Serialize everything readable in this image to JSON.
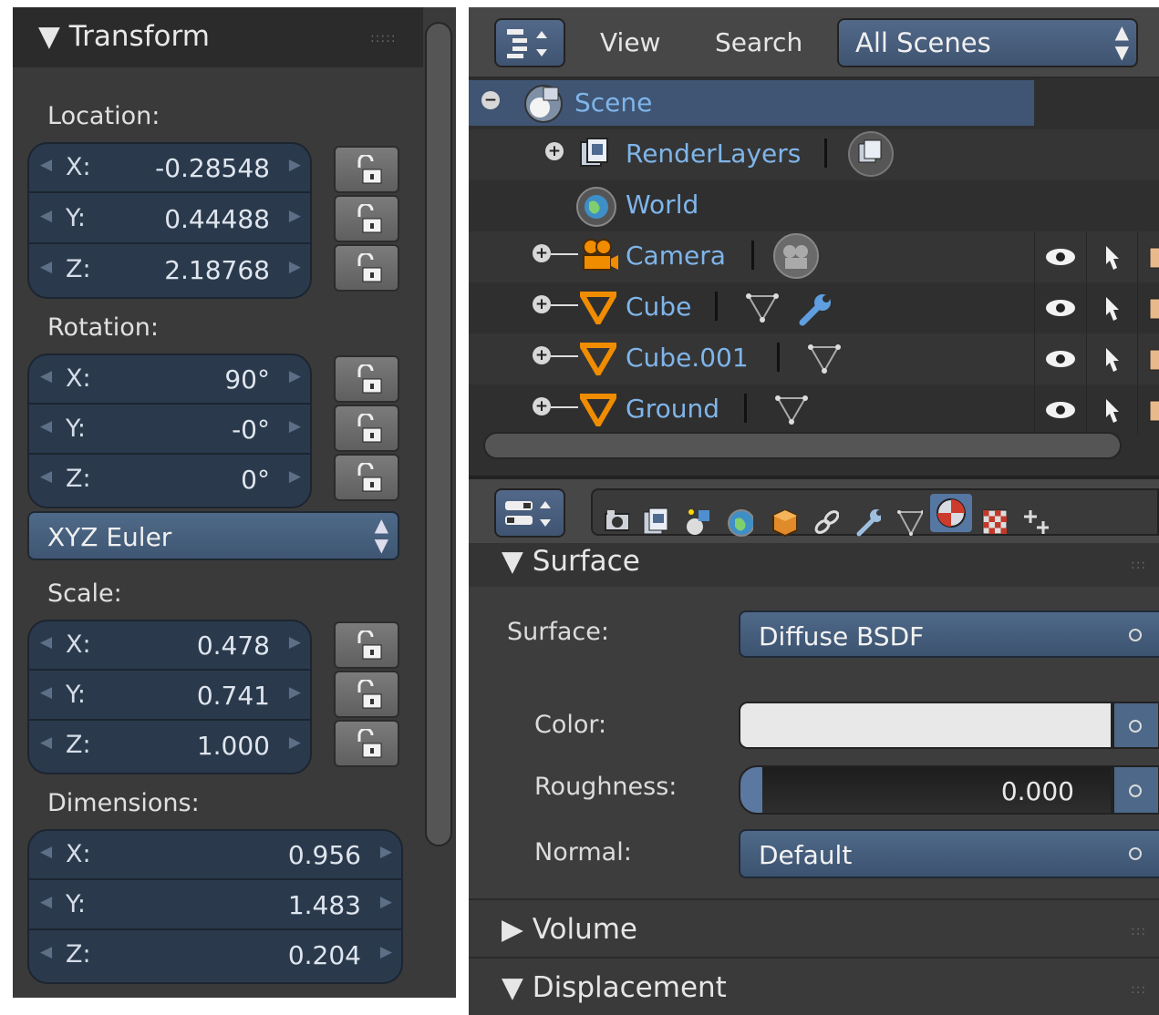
{
  "transform": {
    "title": "Transform",
    "location": {
      "label": "Location:",
      "fields": [
        {
          "axis": "X:",
          "value": "-0.28548"
        },
        {
          "axis": "Y:",
          "value": "0.44488"
        },
        {
          "axis": "Z:",
          "value": "2.18768"
        }
      ]
    },
    "rotation": {
      "label": "Rotation:",
      "fields": [
        {
          "axis": "X:",
          "value": "90°"
        },
        {
          "axis": "Y:",
          "value": "-0°"
        },
        {
          "axis": "Z:",
          "value": "0°"
        }
      ],
      "mode": "XYZ Euler"
    },
    "scale": {
      "label": "Scale:",
      "fields": [
        {
          "axis": "X:",
          "value": "0.478"
        },
        {
          "axis": "Y:",
          "value": "0.741"
        },
        {
          "axis": "Z:",
          "value": "1.000"
        }
      ]
    },
    "dimensions": {
      "label": "Dimensions:",
      "fields": [
        {
          "axis": "X:",
          "value": "0.956"
        },
        {
          "axis": "Y:",
          "value": "1.483"
        },
        {
          "axis": "Z:",
          "value": "0.204"
        }
      ]
    }
  },
  "outliner": {
    "menu": {
      "view": "View",
      "search": "Search"
    },
    "scenes_dropdown": "All Scenes",
    "rows": [
      {
        "name": "Scene",
        "icon": "scene-icon"
      },
      {
        "name": "RenderLayers",
        "icon": "render-layers-icon"
      },
      {
        "name": "World",
        "icon": "world-icon"
      },
      {
        "name": "Camera",
        "icon": "camera-icon"
      },
      {
        "name": "Cube",
        "icon": "mesh-icon"
      },
      {
        "name": "Cube.001",
        "icon": "mesh-icon"
      },
      {
        "name": "Ground",
        "icon": "mesh-icon"
      }
    ]
  },
  "properties": {
    "context_tabs": [
      "render-icon",
      "render-layers-icon",
      "scene-icon",
      "world-icon",
      "object-icon",
      "constraints-icon",
      "modifiers-icon",
      "data-icon",
      "material-icon",
      "texture-icon",
      "particles-icon"
    ],
    "surface_section": {
      "title": "Surface",
      "surface_label": "Surface:",
      "surface_value": "Diffuse BSDF",
      "color_label": "Color:",
      "color_value": "#e8e8e8",
      "roughness_label": "Roughness:",
      "roughness_value": "0.000",
      "normal_label": "Normal:",
      "normal_value": "Default"
    },
    "volume_section": {
      "title": "Volume"
    },
    "displacement_section": {
      "title": "Displacement"
    }
  },
  "colors": {
    "field_blue": "#2a3a4c",
    "accent_blue": "#53698a",
    "outliner_text": "#7fb5ea",
    "selected_row": "#3f5573",
    "mesh_orange": "#f08c00"
  }
}
